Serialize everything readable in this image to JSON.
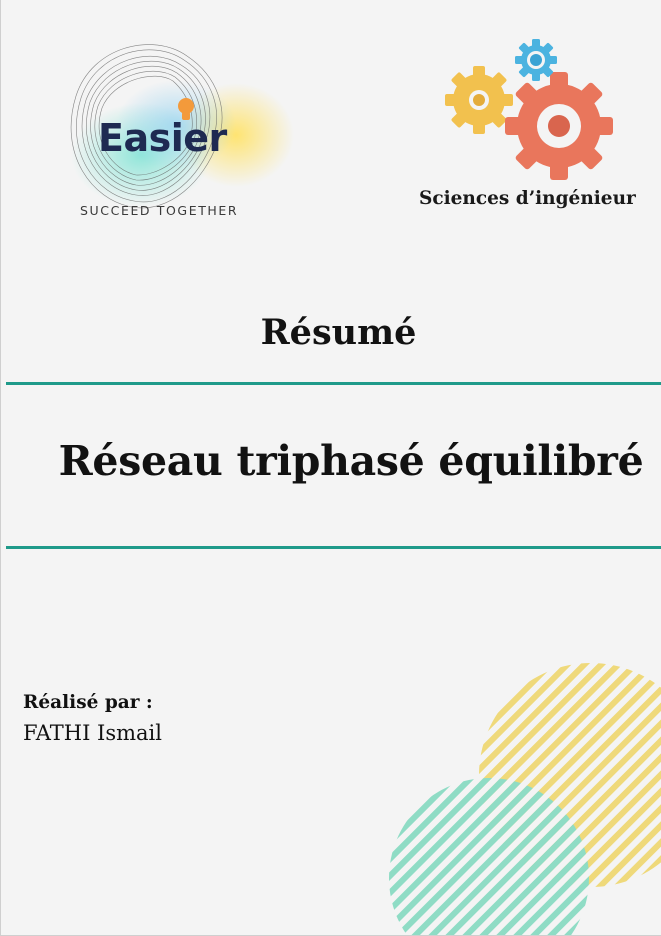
{
  "header": {
    "logo_name": "Easier",
    "logo_tagline": "SUCCEED TOGETHER",
    "subject": "Sciences d’ingénieur"
  },
  "document": {
    "type_label": "Résumé",
    "title": "Réseau triphasé équilibré",
    "author_label": "Réalisé par :",
    "author_name": "FATHI Ismail"
  },
  "colors": {
    "rule": "#1f9a8a",
    "logo_text": "#1e2a52",
    "gear_large": "#e9765c",
    "gear_small": "#f2c14e",
    "gear_blue": "#4bb3e0",
    "decor_yellow": "#efd97a",
    "decor_green": "#8fdcc5"
  },
  "icons": [
    "easier-logo",
    "gears-icon",
    "striped-circles-decoration"
  ]
}
